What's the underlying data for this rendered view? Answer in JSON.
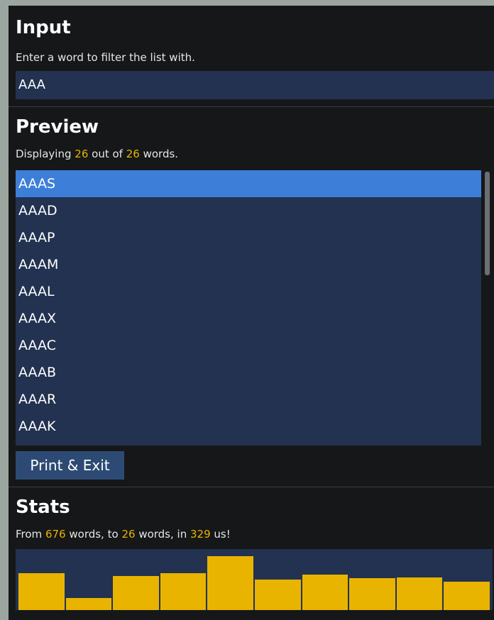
{
  "input": {
    "title": "Input",
    "description": "Enter a word to filter the list with.",
    "value": "AAA"
  },
  "preview": {
    "title": "Preview",
    "desc_prefix": "Displaying",
    "displayed": "26",
    "desc_middle": "out of",
    "total": "26",
    "desc_suffix": "words.",
    "items": [
      "AAAS",
      "AAAD",
      "AAAP",
      "AAAM",
      "AAAL",
      "AAAX",
      "AAAC",
      "AAAB",
      "AAAR",
      "AAAK"
    ],
    "selected_index": 0,
    "scroll_position": 0
  },
  "button": {
    "label": "Print & Exit"
  },
  "stats": {
    "title": "Stats",
    "prefix": "From",
    "from_count": "676",
    "mid1": "words, to",
    "to_count": "26",
    "mid2": "words, in",
    "time": "329",
    "suffix": "us!"
  },
  "chart_data": {
    "type": "bar",
    "values": [
      0.6,
      0.2,
      0.56,
      0.6,
      0.88,
      0.5,
      0.58,
      0.52,
      0.54,
      0.46
    ],
    "color": "#e8b400"
  },
  "colors": {
    "accent": "#e8b400",
    "selection": "#3d7fd8",
    "panel": "#223250",
    "background": "#161718"
  }
}
